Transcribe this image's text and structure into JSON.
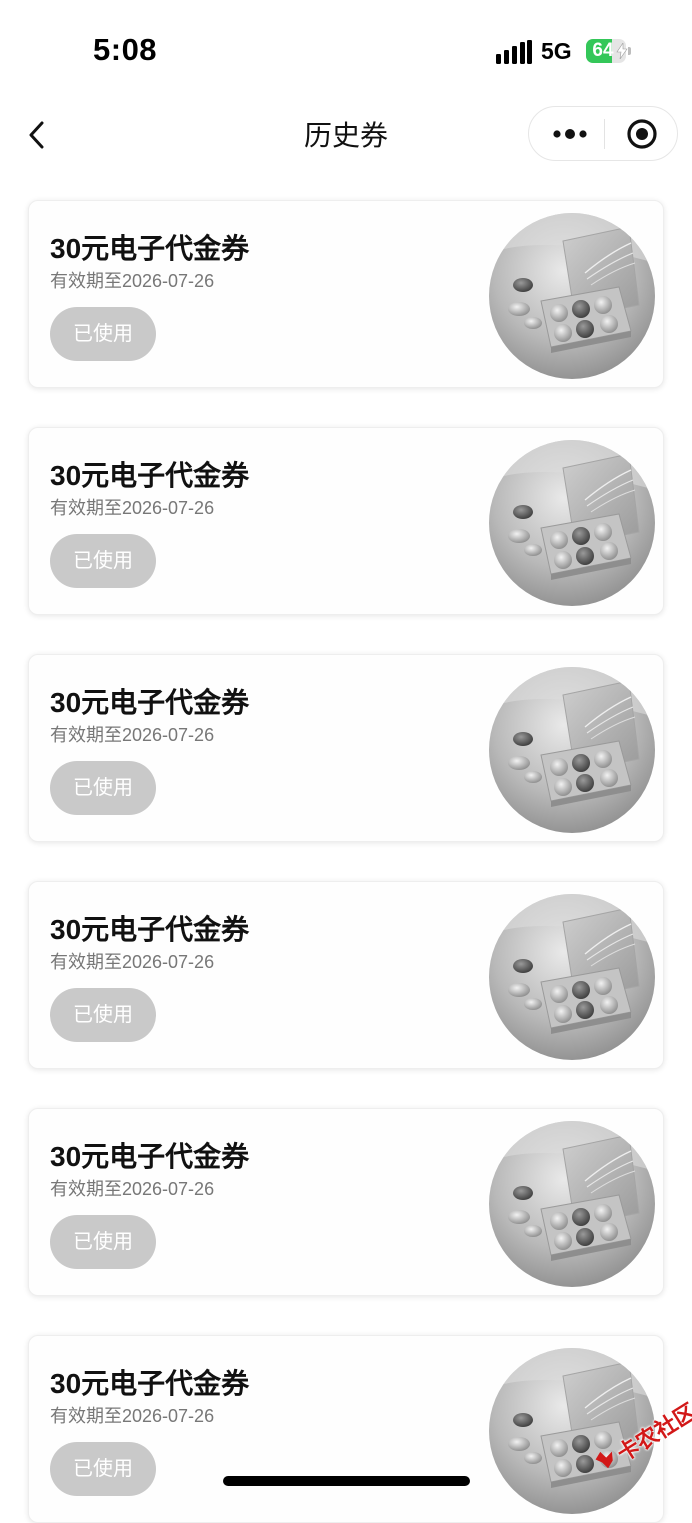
{
  "status_bar": {
    "time": "5:08",
    "network": "5G",
    "battery": "64",
    "battery_level": 0.64
  },
  "nav": {
    "title": "历史券",
    "icons": {
      "back": "chevron-left-icon",
      "more": "more-dots-icon",
      "close": "target-circle-icon"
    }
  },
  "coupons": [
    {
      "title": "30元电子代金券",
      "expiry": "有效期至2026-07-26",
      "status": "已使用"
    },
    {
      "title": "30元电子代金券",
      "expiry": "有效期至2026-07-26",
      "status": "已使用"
    },
    {
      "title": "30元电子代金券",
      "expiry": "有效期至2026-07-26",
      "status": "已使用"
    },
    {
      "title": "30元电子代金券",
      "expiry": "有效期至2026-07-26",
      "status": "已使用"
    },
    {
      "title": "30元电子代金券",
      "expiry": "有效期至2026-07-26",
      "status": "已使用"
    },
    {
      "title": "30元电子代金券",
      "expiry": "有效期至2026-07-26",
      "status": "已使用"
    }
  ],
  "watermark": {
    "text": "卡农社区"
  },
  "colors": {
    "battery": "#34c759",
    "status_button": "#c9c9c9",
    "watermark": "#d21818"
  }
}
